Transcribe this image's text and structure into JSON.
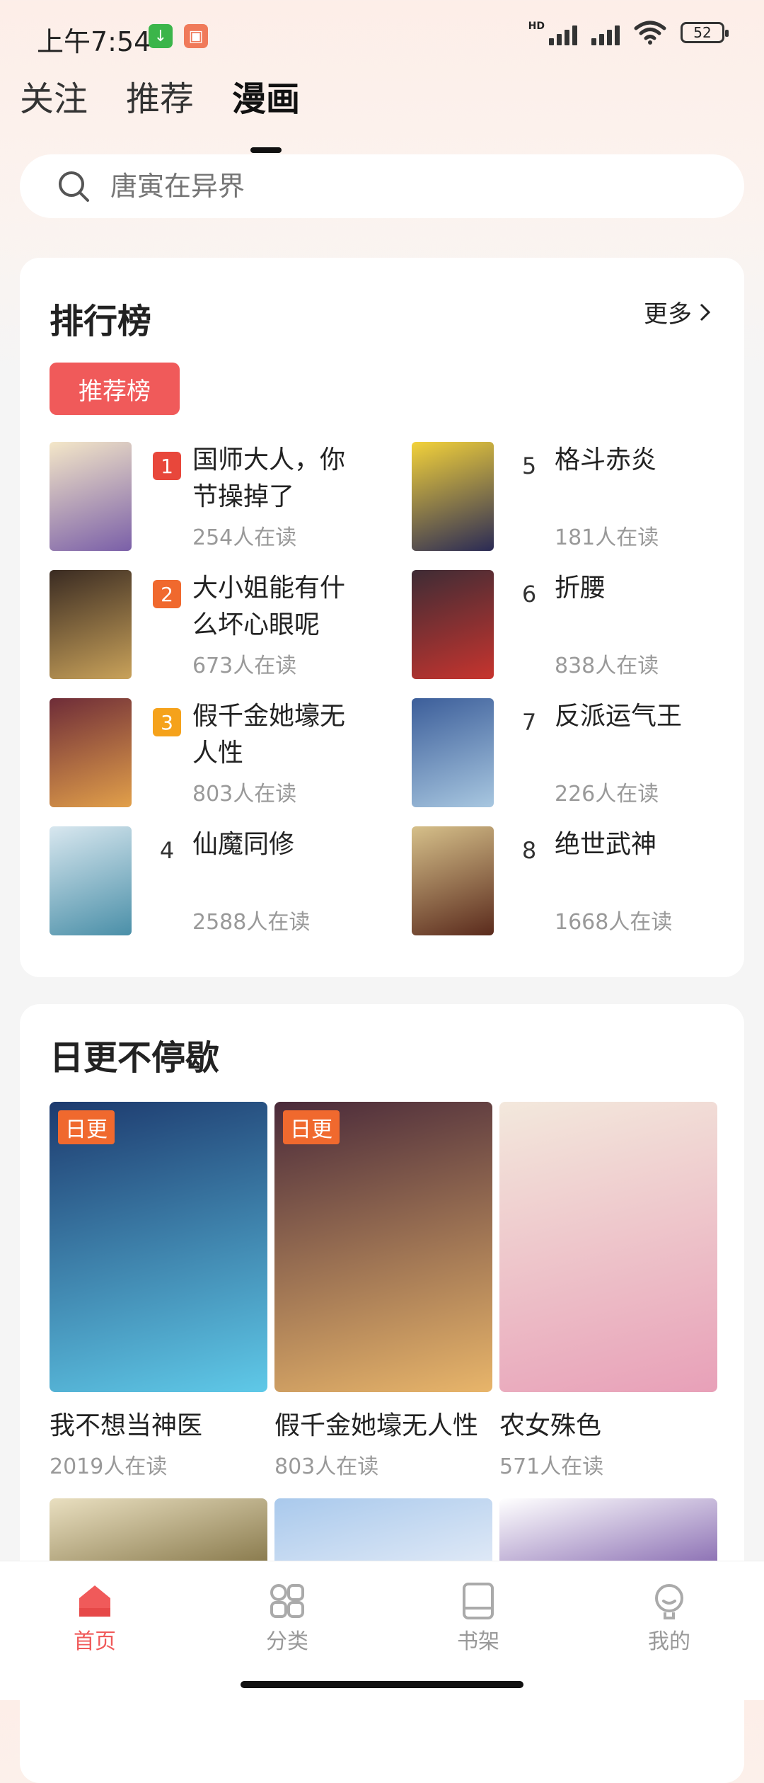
{
  "status_bar": {
    "time": "上午7:54",
    "battery": "52",
    "hd": "HD"
  },
  "tabs": [
    {
      "label": "关注"
    },
    {
      "label": "推荐"
    },
    {
      "label": "漫画"
    }
  ],
  "search": {
    "placeholder": "唐寅在异界"
  },
  "ranking": {
    "title": "排行榜",
    "more": "更多",
    "chip": "推荐榜",
    "items": [
      {
        "rank": "1",
        "title": "国师大人，你节操掉了",
        "readers": "254人在读",
        "badge_color": "#e8473b",
        "cover_colors": [
          "#f4e7c8",
          "#7a5fa8"
        ]
      },
      {
        "rank": "2",
        "title": "大小姐能有什么坏心眼呢",
        "readers": "673人在读",
        "badge_color": "#f0692e",
        "cover_colors": [
          "#3a2b22",
          "#c9a25a"
        ]
      },
      {
        "rank": "3",
        "title": "假千金她壕无人性",
        "readers": "803人在读",
        "badge_color": "#f5a21b",
        "cover_colors": [
          "#6e2c38",
          "#e2a04a"
        ]
      },
      {
        "rank": "4",
        "title": "仙魔同修",
        "readers": "2588人在读",
        "badge_color": "",
        "cover_colors": [
          "#d8e7ef",
          "#4a8fa8"
        ]
      },
      {
        "rank": "5",
        "title": "格斗赤炎",
        "readers": "181人在读",
        "badge_color": "",
        "cover_colors": [
          "#f3d23a",
          "#2a2a55"
        ]
      },
      {
        "rank": "6",
        "title": "折腰",
        "readers": "838人在读",
        "badge_color": "",
        "cover_colors": [
          "#3e2c35",
          "#c7342e"
        ]
      },
      {
        "rank": "7",
        "title": "反派运气王",
        "readers": "226人在读",
        "badge_color": "",
        "cover_colors": [
          "#3c5e9a",
          "#a8c7e0"
        ]
      },
      {
        "rank": "8",
        "title": "绝世武神",
        "readers": "1668人在读",
        "badge_color": "",
        "cover_colors": [
          "#d6c08a",
          "#5a2a1c"
        ]
      }
    ]
  },
  "daily": {
    "title": "日更不停歇",
    "tag": "日更",
    "books": [
      {
        "title": "我不想当神医",
        "readers": "2019人在读",
        "has_tag": true,
        "cover_colors": [
          "#1d3a6e",
          "#5fc9e8"
        ],
        "cover_text": "我不想当神医"
      },
      {
        "title": "假千金她壕无人性",
        "readers": "803人在读",
        "has_tag": true,
        "cover_colors": [
          "#4a2a3a",
          "#e8b56a"
        ],
        "cover_text": "假千金她壕无人性"
      },
      {
        "title": "农女殊色",
        "readers": "571人在读",
        "has_tag": false,
        "cover_colors": [
          "#f3e8dc",
          "#e8a0b8"
        ],
        "cover_text": "农女殊色"
      }
    ],
    "row2_colors": [
      [
        "#e9dfc0",
        "#7a6a3a"
      ],
      [
        "#a9c9ec",
        "#e8eef8"
      ],
      [
        "#ffffff",
        "#7a5aa8"
      ]
    ]
  },
  "bottom_nav": [
    {
      "label": "首页",
      "icon": "home-icon",
      "active": true
    },
    {
      "label": "分类",
      "icon": "category-icon",
      "active": false
    },
    {
      "label": "书架",
      "icon": "bookshelf-icon",
      "active": false
    },
    {
      "label": "我的",
      "icon": "profile-icon",
      "active": false
    }
  ],
  "colors": {
    "accent": "#f05a5a"
  }
}
